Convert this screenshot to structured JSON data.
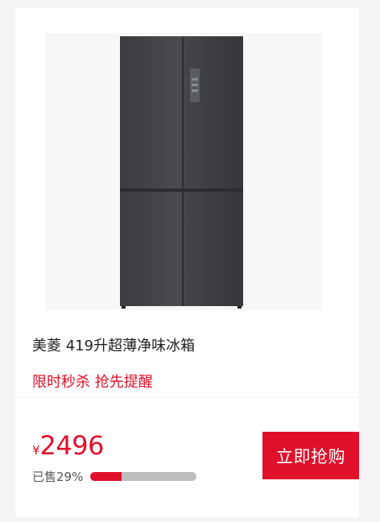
{
  "product": {
    "title": "美菱 419升超薄净味冰箱",
    "promo": "限时秒杀 抢先提醒",
    "image_icon": "four-door-refrigerator"
  },
  "pricing": {
    "currency": "¥",
    "amount": "2496"
  },
  "sales": {
    "label": "已售29%",
    "progress": 0.29
  },
  "actions": {
    "buy_label": "立即抢购"
  },
  "colors": {
    "accent": "#e0102a",
    "progress_track": "#bdbdbd",
    "fridge_body": "#3a3c3f"
  }
}
